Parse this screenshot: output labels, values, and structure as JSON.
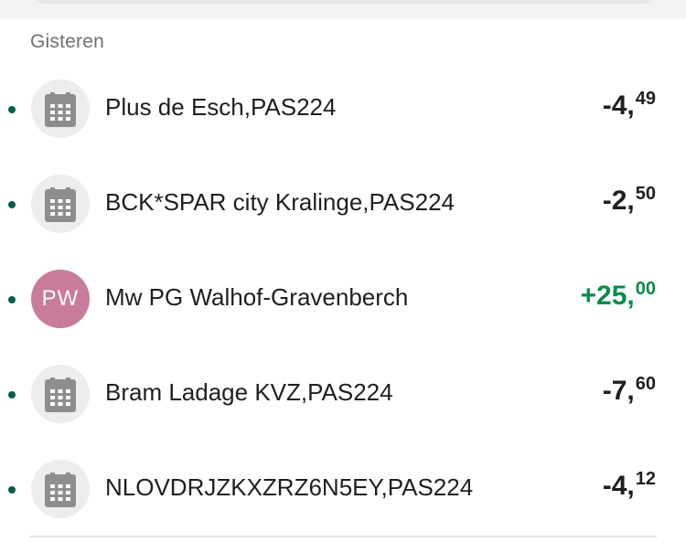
{
  "section": {
    "date_header": "Gisteren"
  },
  "transactions": [
    {
      "icon": "receipt-icon",
      "name": "Plus de Esch,PAS224",
      "amount_int": "-4,",
      "amount_dec": "49",
      "direction": "debit"
    },
    {
      "icon": "receipt-icon",
      "name": "BCK*SPAR city Kralinge,PAS224",
      "amount_int": "-2,",
      "amount_dec": "50",
      "direction": "debit"
    },
    {
      "initials": "PW",
      "avatar_color": "#c97b9b",
      "name": "Mw PG Walhof-Gravenberch",
      "amount_int": "+25,",
      "amount_dec": "00",
      "direction": "credit"
    },
    {
      "icon": "receipt-icon",
      "name": "Bram Ladage KVZ,PAS224",
      "amount_int": "-7,",
      "amount_dec": "60",
      "direction": "debit"
    },
    {
      "icon": "receipt-icon",
      "name": "NLOVDRJZKXZRZ6N5EY,PAS224",
      "amount_int": "-4,",
      "amount_dec": "12",
      "direction": "debit"
    }
  ],
  "colors": {
    "unread_dot": "#00614a",
    "credit_amount": "#0a8a4b",
    "debit_amount": "#1f1f1f",
    "icon_grey": "#8e8e8e"
  }
}
